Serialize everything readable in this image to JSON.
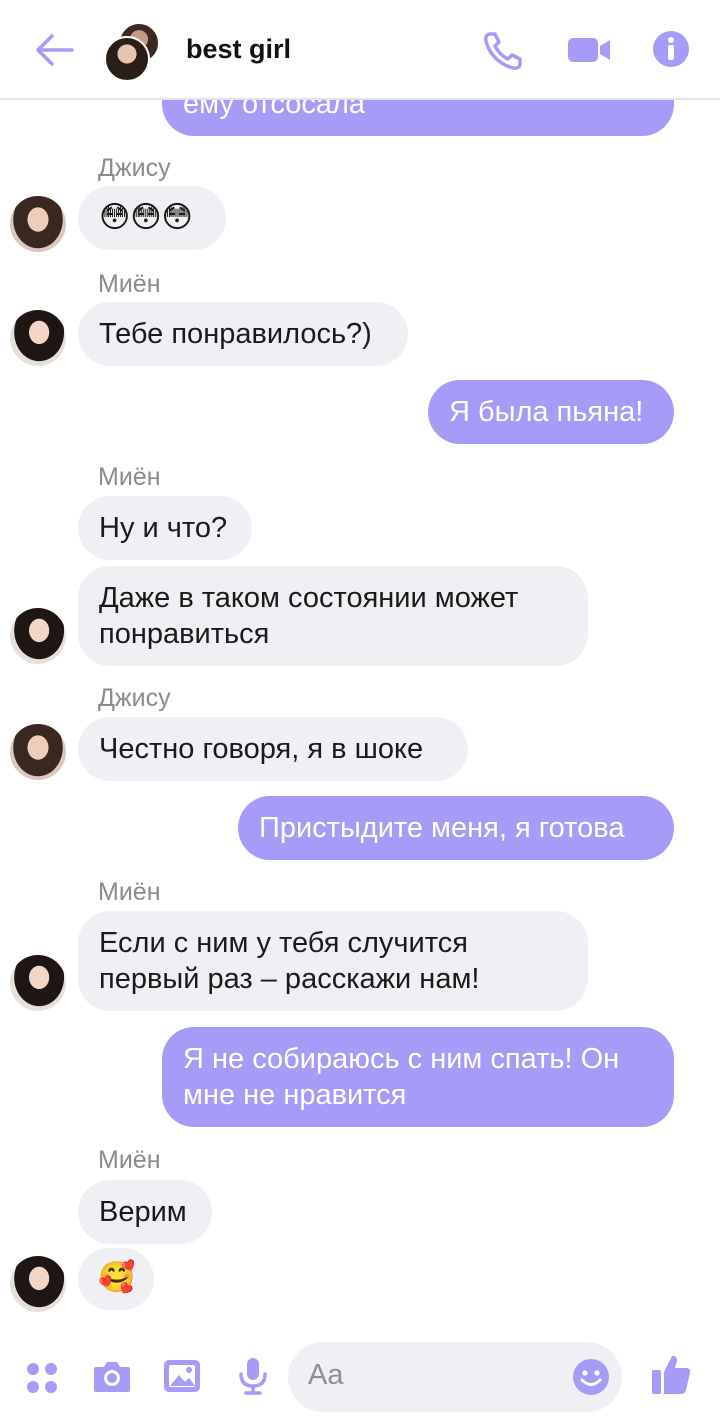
{
  "header": {
    "title": "best girl",
    "icons": [
      "back-arrow-icon",
      "phone-icon",
      "video-camera-icon",
      "info-icon"
    ]
  },
  "colors": {
    "accent": "#a79bf8",
    "incoming_bubble": "#f0eff3",
    "sender_name": "#8a8a90"
  },
  "messages": {
    "m0": "ему отсосала",
    "s1": "Джису",
    "m1": "😳😳😳",
    "s2": "Миён",
    "m2": "Тебе понравилось?)",
    "m3": "Я была пьяна!",
    "s4": "Миён",
    "m4": "Ну и что?",
    "m5a": "Даже в таком состоянии может",
    "m5b": "понравиться",
    "s6": "Джису",
    "m6": "Честно говоря, я в шоке",
    "m7": "Пристыдите меня, я готова",
    "s8": "Миён",
    "m8a": "Если с ним у тебя случится",
    "m8b": "первый раз – расскажи нам!",
    "m9a": "Я не собираюсь с ним спать! Он",
    "m9b": "мне не нравится",
    "s10": "Миён",
    "m10": "Верим",
    "m11": "🥰"
  },
  "composer": {
    "placeholder": "Aa",
    "icons": [
      "apps-icon",
      "camera-icon",
      "image-icon",
      "microphone-icon",
      "emoji-icon",
      "thumbs-up-icon"
    ]
  }
}
